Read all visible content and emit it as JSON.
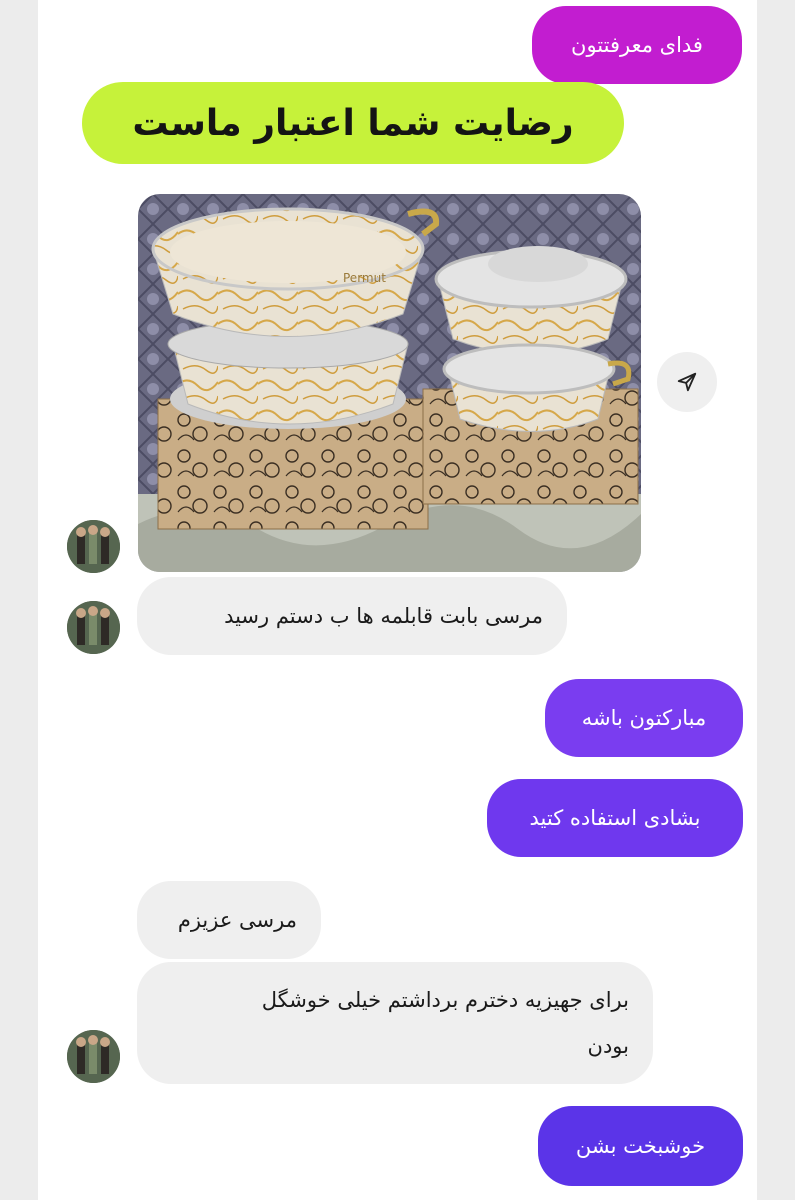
{
  "messages": {
    "m1": "فدای معرفتتون",
    "banner": "رضایت شما اعتبار ماست",
    "m2": "مرسی بابت قابلمه ها ب دستم رسید",
    "m3": "مبارکتون باشه",
    "m4": "بشادی استفاده کتید",
    "m5": "مرسی عزیزم",
    "m6_line1": "برای جهیزیه دخترم برداشتم خیلی خوشگل",
    "m6_line2": "بودن",
    "m7": "خوشبخت بشن"
  },
  "photo": {
    "brand_text": "Permut"
  },
  "icons": {
    "share": "send-icon",
    "avatar": "user-avatar"
  },
  "colors": {
    "magenta": "#c21dd0",
    "lime": "#c6f23a",
    "purple": "#7a3df0",
    "blue": "#5b34e8",
    "incoming": "#efefef"
  }
}
